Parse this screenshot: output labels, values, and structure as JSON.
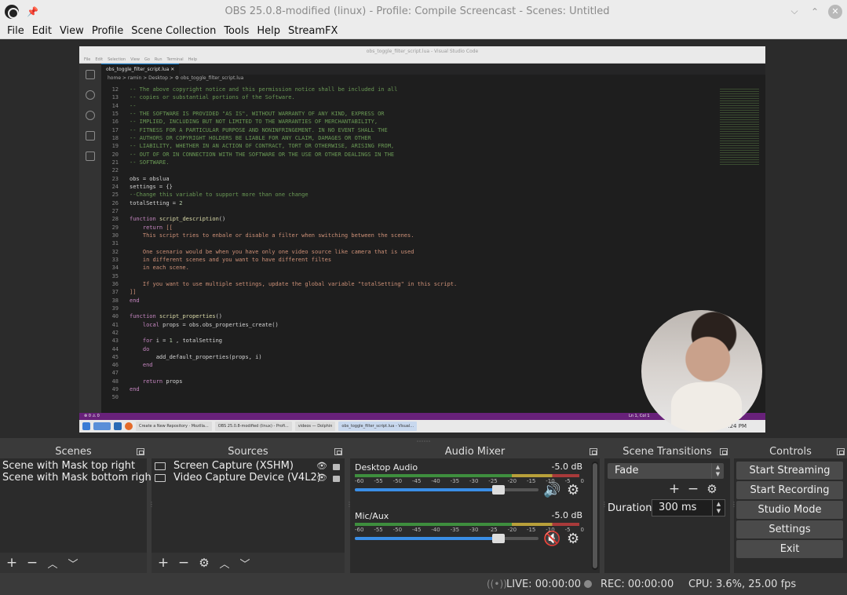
{
  "window": {
    "title": "OBS 25.0.8-modified (linux) - Profile: Compile Screencast - Scenes: Untitled",
    "minimize_glyph": "⌵",
    "maximize_glyph": "⌃",
    "close_glyph": "✕"
  },
  "menu": [
    "File",
    "Edit",
    "View",
    "Profile",
    "Scene Collection",
    "Tools",
    "Help",
    "StreamFX"
  ],
  "preview": {
    "vscode_title": "obs_toggle_filter_script.lua - Visual Studio Code",
    "vscode_menu": [
      "File",
      "Edit",
      "Selection",
      "View",
      "Go",
      "Run",
      "Terminal",
      "Help"
    ],
    "tab": "obs_toggle_filter_script.lua ✕",
    "breadcrumb": "home > ramin > Desktop > ⚙ obs_toggle_filter_script.lua",
    "code_lines": [
      {
        "n": "12",
        "parts": [
          {
            "c": "cm",
            "t": "-- The above copyright notice and this permission notice shall be included in all"
          }
        ]
      },
      {
        "n": "13",
        "parts": [
          {
            "c": "cm",
            "t": "-- copies or substantial portions of the Software."
          }
        ]
      },
      {
        "n": "14",
        "parts": [
          {
            "c": "cm",
            "t": "--"
          }
        ]
      },
      {
        "n": "15",
        "parts": [
          {
            "c": "cm",
            "t": "-- THE SOFTWARE IS PROVIDED \"AS IS\", WITHOUT WARRANTY OF ANY KIND, EXPRESS OR"
          }
        ]
      },
      {
        "n": "16",
        "parts": [
          {
            "c": "cm",
            "t": "-- IMPLIED, INCLUDING BUT NOT LIMITED TO THE WARRANTIES OF MERCHANTABILITY,"
          }
        ]
      },
      {
        "n": "17",
        "parts": [
          {
            "c": "cm",
            "t": "-- FITNESS FOR A PARTICULAR PURPOSE AND NONINFRINGEMENT. IN NO EVENT SHALL THE"
          }
        ]
      },
      {
        "n": "18",
        "parts": [
          {
            "c": "cm",
            "t": "-- AUTHORS OR COPYRIGHT HOLDERS BE LIABLE FOR ANY CLAIM, DAMAGES OR OTHER"
          }
        ]
      },
      {
        "n": "19",
        "parts": [
          {
            "c": "cm",
            "t": "-- LIABILITY, WHETHER IN AN ACTION OF CONTRACT, TORT OR OTHERWISE, ARISING FROM,"
          }
        ]
      },
      {
        "n": "20",
        "parts": [
          {
            "c": "cm",
            "t": "-- OUT OF OR IN CONNECTION WITH THE SOFTWARE OR THE USE OR OTHER DEALINGS IN THE"
          }
        ]
      },
      {
        "n": "21",
        "parts": [
          {
            "c": "cm",
            "t": "-- SOFTWARE."
          }
        ]
      },
      {
        "n": "22",
        "parts": [
          {
            "c": "tx",
            "t": ""
          }
        ]
      },
      {
        "n": "23",
        "parts": [
          {
            "c": "tx",
            "t": "obs = obslua"
          }
        ]
      },
      {
        "n": "24",
        "parts": [
          {
            "c": "tx",
            "t": "settings = {}"
          }
        ]
      },
      {
        "n": "25",
        "parts": [
          {
            "c": "cm",
            "t": "--Change this variable to support more than one change"
          }
        ]
      },
      {
        "n": "26",
        "parts": [
          {
            "c": "tx",
            "t": "totalSetting = "
          },
          {
            "c": "num",
            "t": "2"
          }
        ]
      },
      {
        "n": "27",
        "parts": [
          {
            "c": "tx",
            "t": ""
          }
        ]
      },
      {
        "n": "28",
        "parts": [
          {
            "c": "kw",
            "t": "function "
          },
          {
            "c": "fn",
            "t": "script_description"
          },
          {
            "c": "tx",
            "t": "()"
          }
        ]
      },
      {
        "n": "29",
        "parts": [
          {
            "c": "kw",
            "t": "    return "
          },
          {
            "c": "str",
            "t": "[["
          }
        ]
      },
      {
        "n": "30",
        "parts": [
          {
            "c": "str",
            "t": "    This script tries to enbale or disable a filter when switching between the scenes."
          }
        ]
      },
      {
        "n": "31",
        "parts": [
          {
            "c": "tx",
            "t": ""
          }
        ]
      },
      {
        "n": "32",
        "parts": [
          {
            "c": "str",
            "t": "    One scenario would be when you have only one video source like camera that is used"
          }
        ]
      },
      {
        "n": "33",
        "parts": [
          {
            "c": "str",
            "t": "    in different scenes and you want to have different filtes"
          }
        ]
      },
      {
        "n": "34",
        "parts": [
          {
            "c": "str",
            "t": "    in each scene."
          }
        ]
      },
      {
        "n": "35",
        "parts": [
          {
            "c": "tx",
            "t": ""
          }
        ]
      },
      {
        "n": "36",
        "parts": [
          {
            "c": "str",
            "t": "    If you want to use multiple settings, update the global variable \"totalSetting\" in this script."
          }
        ]
      },
      {
        "n": "37",
        "parts": [
          {
            "c": "str",
            "t": "]]"
          }
        ]
      },
      {
        "n": "38",
        "parts": [
          {
            "c": "kw",
            "t": "end"
          }
        ]
      },
      {
        "n": "39",
        "parts": [
          {
            "c": "tx",
            "t": ""
          }
        ]
      },
      {
        "n": "40",
        "parts": [
          {
            "c": "kw",
            "t": "function "
          },
          {
            "c": "fn",
            "t": "script_properties"
          },
          {
            "c": "tx",
            "t": "()"
          }
        ]
      },
      {
        "n": "41",
        "parts": [
          {
            "c": "kw",
            "t": "    local "
          },
          {
            "c": "tx",
            "t": "props = obs.obs_properties_create()"
          }
        ]
      },
      {
        "n": "42",
        "parts": [
          {
            "c": "tx",
            "t": ""
          }
        ]
      },
      {
        "n": "43",
        "parts": [
          {
            "c": "kw",
            "t": "    for "
          },
          {
            "c": "tx",
            "t": "i = "
          },
          {
            "c": "num",
            "t": "1"
          },
          {
            "c": "tx",
            "t": " , totalSetting"
          }
        ]
      },
      {
        "n": "44",
        "parts": [
          {
            "c": "kw",
            "t": "    do"
          }
        ]
      },
      {
        "n": "45",
        "parts": [
          {
            "c": "tx",
            "t": "        add_default_properties(props, i)"
          }
        ]
      },
      {
        "n": "46",
        "parts": [
          {
            "c": "kw",
            "t": "    end"
          }
        ]
      },
      {
        "n": "47",
        "parts": [
          {
            "c": "tx",
            "t": ""
          }
        ]
      },
      {
        "n": "48",
        "parts": [
          {
            "c": "kw",
            "t": "    return "
          },
          {
            "c": "tx",
            "t": "props"
          }
        ]
      },
      {
        "n": "49",
        "parts": [
          {
            "c": "kw",
            "t": "end"
          }
        ]
      },
      {
        "n": "50",
        "parts": [
          {
            "c": "tx",
            "t": ""
          }
        ]
      }
    ],
    "vs_status": "⊗ 0 ⚠ 0",
    "vs_status_right": "Ln 1, Col 1",
    "taskbar_items": [
      "Create a New Repository · Mozilla...",
      "OBS 25.0.8-modified (linux) - Profi...",
      "videos — Dolphin",
      "obs_toggle_filter_script.lua - Visual..."
    ],
    "taskbar_time": ":24 PM"
  },
  "scenes": {
    "title": "Scenes",
    "items": [
      "Scene with Mask top right",
      "Scene with Mask bottom right"
    ]
  },
  "sources": {
    "title": "Sources",
    "items": [
      "Screen Capture (XSHM)",
      "Video Capture Device (V4L2)"
    ]
  },
  "mixer": {
    "title": "Audio Mixer",
    "ticks": [
      "-60",
      "-55",
      "-50",
      "-45",
      "-40",
      "-35",
      "-30",
      "-25",
      "-20",
      "-15",
      "-10",
      "-5",
      "0"
    ],
    "channels": [
      {
        "name": "Desktop Audio",
        "db": "-5.0 dB",
        "level": 0.78,
        "muted": false
      },
      {
        "name": "Mic/Aux",
        "db": "-5.0 dB",
        "level": 0.78,
        "muted": true
      }
    ]
  },
  "transitions": {
    "title": "Scene Transitions",
    "selected": "Fade",
    "duration_label": "Duration",
    "duration_value": "300 ms"
  },
  "controls": {
    "title": "Controls",
    "buttons": [
      "Start Streaming",
      "Start Recording",
      "Studio Mode",
      "Settings",
      "Exit"
    ]
  },
  "status": {
    "live": "LIVE: 00:00:00",
    "rec": "REC: 00:00:00",
    "cpu": "CPU: 3.6%, 25.00 fps"
  },
  "colors": {
    "accent": "#3a8ee6",
    "mute_red": "#d33333",
    "vscode_status": "#68217a"
  }
}
